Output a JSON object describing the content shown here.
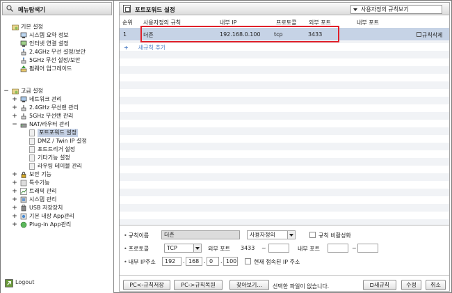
{
  "sidebar": {
    "title": "메뉴탐색기",
    "basic": {
      "label": "기본 설정",
      "items": [
        "시스템 요약 정보",
        "인터넷 연결 설정",
        "2.4GHz 무선 설정/보안",
        "5GHz 무선 설정/보안",
        "펌웨어 업그레이드"
      ]
    },
    "advanced": {
      "label": "고급 설정",
      "items": [
        "네트워크 관리",
        "2.4GHz 무선랜 관리",
        "5GHz 무선랜 관리",
        "NAT/라우터 관리"
      ],
      "nat_sub": [
        "포트포워드 설정",
        "DMZ / Twin IP 설정",
        "포트트리거 설정",
        "기타기능 설정",
        "라우팅 테이블 관리"
      ],
      "more": [
        "보안 기능",
        "특수기능",
        "트래픽 관리",
        "시스템 관리",
        "USB 저장장치",
        "기본 내장 App관리",
        "Plug-in App관리"
      ]
    },
    "logout": "Logout"
  },
  "main": {
    "title": "포트포워드 설정",
    "view_select": "사용자정의 규칙보기",
    "columns": [
      "순위",
      "사용자정의 규칙",
      "내부 IP",
      "프로토콜",
      "외부 포트",
      "내부 포트"
    ],
    "rows": [
      {
        "rank": "1",
        "name": "더존",
        "internal_ip": "192.168.0.100",
        "protocol": "tcp",
        "external_port": "3433",
        "internal_port": ""
      }
    ],
    "delete_label": "규칙삭제",
    "add_label": "새규칙 추가"
  },
  "form": {
    "rule_name_label": "규칙이름",
    "rule_name_value": "더존",
    "rule_type": "사용자정의",
    "disable_label": "규칙 비활성화",
    "protocol_label": "프로토콜",
    "protocol_value": "TCP",
    "ext_port_label": "외부 포트",
    "ext_port_from": "3433",
    "ext_port_to": "",
    "tilde": "~",
    "int_port_label": "내부 포트",
    "int_port_from": "",
    "int_port_to": "",
    "ip_label": "내부 IP주소",
    "ip": [
      "192",
      "168",
      "0",
      "100"
    ],
    "dot": ".",
    "current_ip_label": "현재 접속된 IP 주소"
  },
  "buttons": {
    "save_pc": "PC<-규칙저장",
    "restore_pc": "PC->규칙복원",
    "browse": "찾아보기...",
    "no_file": "선택한 파일이 없습니다.",
    "new_rule": "새규칙",
    "modify": "수정",
    "cancel": "취소"
  }
}
